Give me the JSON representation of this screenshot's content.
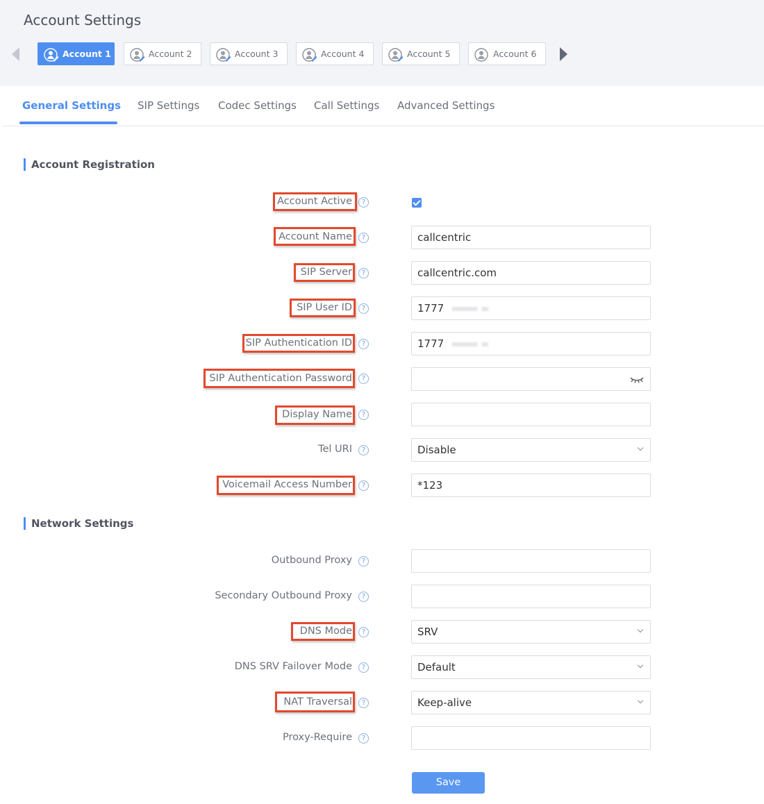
{
  "page_title": "Account Settings",
  "accounts": [
    {
      "label": "Account 1",
      "active": true
    },
    {
      "label": "Account 2",
      "active": false
    },
    {
      "label": "Account 3",
      "active": false
    },
    {
      "label": "Account 4",
      "active": false
    },
    {
      "label": "Account 5",
      "active": false
    },
    {
      "label": "Account 6",
      "active": false
    }
  ],
  "sub_tabs": [
    "General Settings",
    "SIP Settings",
    "Codec Settings",
    "Call Settings",
    "Advanced Settings"
  ],
  "sections": {
    "account_registration": "Account Registration",
    "network_settings": "Network Settings"
  },
  "fields": {
    "account_active": {
      "label": "Account Active",
      "checked": true
    },
    "account_name": {
      "label": "Account Name",
      "value": "callcentric"
    },
    "sip_server": {
      "label": "SIP Server",
      "value": "callcentric.com"
    },
    "sip_user_id": {
      "label": "SIP User ID",
      "value": "1777"
    },
    "sip_auth_id": {
      "label": "SIP Authentication ID",
      "value": "1777"
    },
    "sip_auth_password": {
      "label": "SIP Authentication Password",
      "value": ""
    },
    "display_name": {
      "label": "Display Name",
      "value": ""
    },
    "tel_uri": {
      "label": "Tel URI",
      "value": "Disable"
    },
    "voicemail_number": {
      "label": "Voicemail Access Number",
      "value": "*123"
    },
    "outbound_proxy": {
      "label": "Outbound Proxy",
      "value": ""
    },
    "secondary_outbound_proxy": {
      "label": "Secondary Outbound Proxy",
      "value": ""
    },
    "dns_mode": {
      "label": "DNS Mode",
      "value": "SRV"
    },
    "dns_srv_failover": {
      "label": "DNS SRV Failover Mode",
      "value": "Default"
    },
    "nat_traversal": {
      "label": "NAT Traversal",
      "value": "Keep-alive"
    },
    "proxy_require": {
      "label": "Proxy-Require",
      "value": ""
    }
  },
  "help_glyph": "?",
  "save_label": "Save",
  "colors": {
    "accent": "#4d8ef0",
    "highlight": "#e2492d",
    "header_bg": "#f2f4f8"
  }
}
